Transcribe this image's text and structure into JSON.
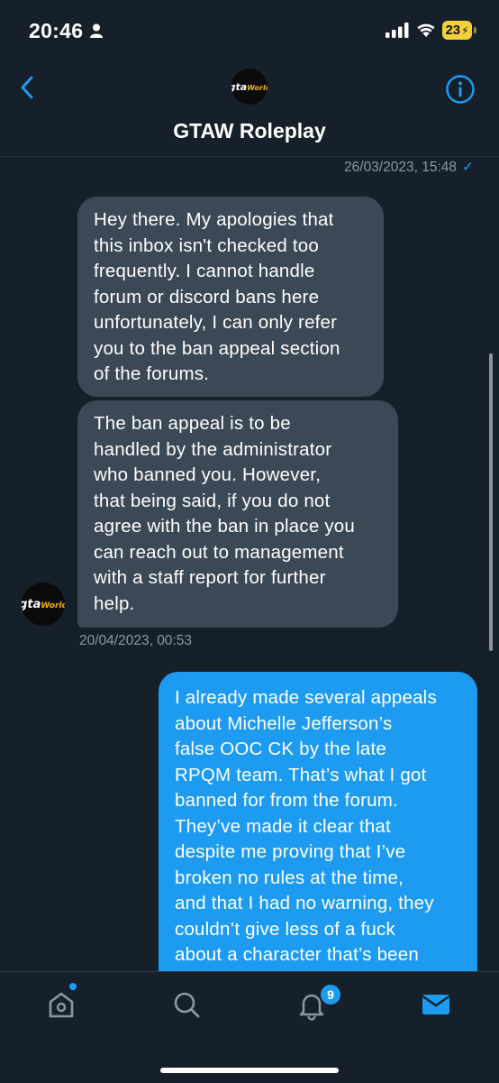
{
  "status_bar": {
    "time": "20:46",
    "battery": "23",
    "icons": [
      "person-icon",
      "signal-icon",
      "wifi-icon",
      "battery-charging-icon"
    ]
  },
  "header": {
    "title": "GTAW Roleplay",
    "avatar_logo": {
      "part1": "gta",
      "part2": "World"
    },
    "icons": [
      "back-chevron-icon",
      "info-icon"
    ]
  },
  "conversation": {
    "timestamp_top": "26/03/2023, 15:48",
    "timestamp_top_check": "✓",
    "messages": [
      {
        "direction": "incoming",
        "text": "Hey there. My apologies that\nthis inbox isn't checked too\nfrequently. I cannot handle\nforum or discord bans here\nunfortunately, I can only refer\nyou to the ban appeal section\nof the forums."
      },
      {
        "direction": "incoming",
        "text": "The ban appeal is to be\nhandled by the administrator\nwho banned you. However,\nthat being said, if you do not\nagree with the ban in place you\ncan reach out to management\nwith a staff report for further\nhelp."
      },
      {
        "direction": "outgoing",
        "text": "I already made several appeals\nabout Michelle Jefferson’s\nfalse OOC CK by the late\nRPQM team. That’s what I got\nbanned for from the forum.\nThey’ve made it clear that\ndespite me proving that I’ve\nbroken no rules at the time,\nand that I had no warning, they\ncouldn’t give less of a fuck\nabout a character that’s been"
      }
    ],
    "timestamp_mid": "20/04/2023, 00:53"
  },
  "tab_bar": {
    "items": [
      {
        "name": "home",
        "icon": "home-icon",
        "has_dot": true
      },
      {
        "name": "search",
        "icon": "search-icon"
      },
      {
        "name": "notifications",
        "icon": "bell-icon",
        "badge": "9"
      },
      {
        "name": "messages",
        "icon": "mail-icon",
        "active": true
      }
    ]
  },
  "colors": {
    "background": "#15202b",
    "incoming_bubble": "#3b4856",
    "outgoing_bubble": "#1d9bf0",
    "accent": "#1d9bf0",
    "muted_text": "#8b98a5"
  }
}
